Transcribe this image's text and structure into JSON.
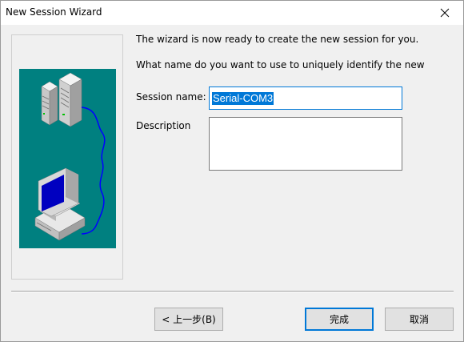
{
  "window": {
    "title": "New Session Wizard"
  },
  "icons": {
    "close": "close-icon",
    "illustration": "server-to-computer-connection-graphic"
  },
  "content": {
    "intro_text": "The wizard is now ready to create the new session for you.",
    "question_text": "What name do you want to use to uniquely identify the new session?"
  },
  "form": {
    "session_name_label": "Session name:",
    "session_name_value": "Serial-COM3",
    "description_label": "Description",
    "description_value": ""
  },
  "buttons": {
    "back": "< 上一步(B)",
    "finish": "完成",
    "cancel": "取消"
  },
  "colors": {
    "accent": "#0078d7",
    "illustration_bg": "#008080",
    "selection": "#0078d7"
  }
}
